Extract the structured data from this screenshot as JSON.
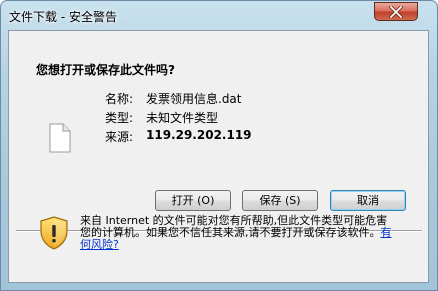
{
  "window": {
    "title": "文件下载 - 安全警告"
  },
  "dialog": {
    "heading": "您想打开或保存此文件吗?",
    "file": {
      "name_label": "名称:",
      "name_value": "发票领用信息.dat",
      "type_label": "类型:",
      "type_value": "未知文件类型",
      "source_label": "来源:",
      "source_value": "119.29.202.119"
    },
    "buttons": {
      "open": "打开 (O)",
      "save": "保存 (S)",
      "cancel": "取消"
    },
    "warning": {
      "text": "来自 Internet 的文件可能对您有所帮助,但此文件类型可能危害您的计算机。如果您不信任其来源,请不要打开或保存该软件。",
      "link": "有何风险?"
    }
  },
  "icons": {
    "file": "generic-file-icon",
    "shield": "security-shield-icon",
    "close": "close-icon"
  },
  "colors": {
    "close_button": "#c1402a",
    "link": "#0033cc",
    "default_button_border": "#3c7fb1"
  }
}
